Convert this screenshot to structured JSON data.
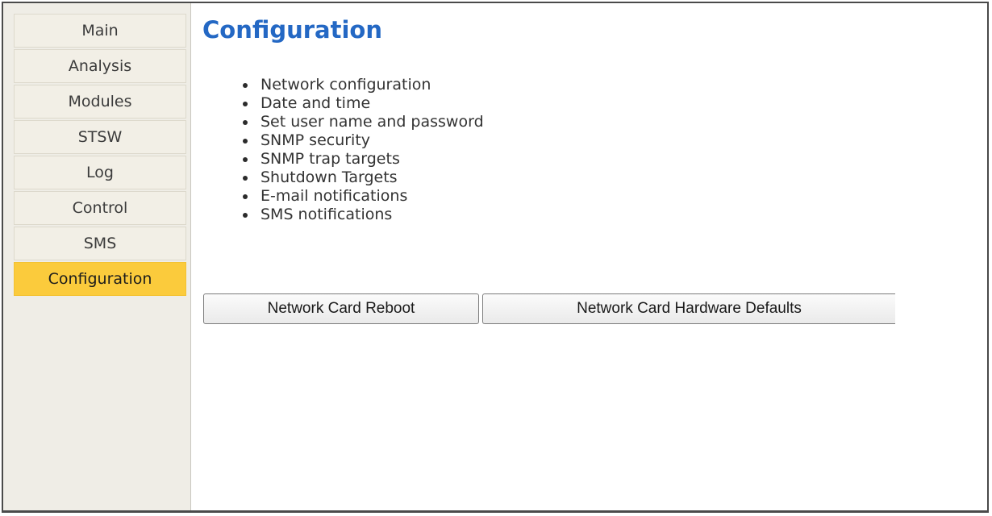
{
  "sidebar": {
    "items": [
      {
        "label": "Main",
        "active": false
      },
      {
        "label": "Analysis",
        "active": false
      },
      {
        "label": "Modules",
        "active": false
      },
      {
        "label": "STSW",
        "active": false
      },
      {
        "label": "Log",
        "active": false
      },
      {
        "label": "Control",
        "active": false
      },
      {
        "label": "SMS",
        "active": false
      },
      {
        "label": "Configuration",
        "active": true
      }
    ]
  },
  "main": {
    "title": "Configuration",
    "links": [
      "Network configuration",
      "Date and time",
      "Set user name and password",
      "SNMP security",
      "SNMP trap targets",
      "Shutdown Targets",
      "E-mail notifications",
      "SMS notifications"
    ],
    "buttons": {
      "reboot": "Network Card Reboot",
      "defaults": "Network Card Hardware Defaults"
    }
  },
  "colors": {
    "accent": "#fbcb3c",
    "title": "#2468c4",
    "sidebar_bg": "#efede6"
  }
}
